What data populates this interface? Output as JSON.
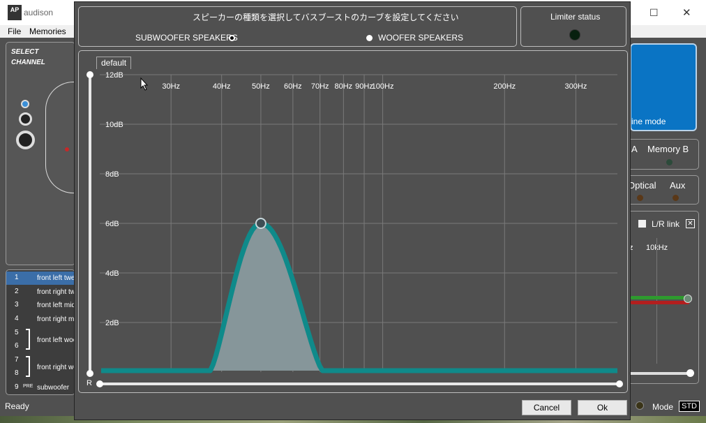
{
  "app": {
    "title": "audison",
    "logo_text": "AP",
    "menu": [
      "File",
      "Memories"
    ],
    "window_controls": {
      "maximize": "☐",
      "close": "✕"
    }
  },
  "left_panel": {
    "select_channel": "SELECT CHANNEL",
    "channels": [
      {
        "num": "1",
        "label": "front left twe"
      },
      {
        "num": "2",
        "label": "front right tw"
      },
      {
        "num": "3",
        "label": "front left mid"
      },
      {
        "num": "4",
        "label": "front right mi"
      },
      {
        "num": "5",
        "label": ""
      },
      {
        "num": "6",
        "label": "front left woo"
      },
      {
        "num": "7",
        "label": ""
      },
      {
        "num": "8",
        "label": "front right wo"
      },
      {
        "num": "9",
        "pre": "PRE",
        "label": "subwoofer"
      }
    ],
    "status": "Ready"
  },
  "right_panel": {
    "mode_label": "ine mode",
    "memory_a": "A",
    "memory_b": "Memory B",
    "optical": "Optical",
    "aux": "Aux",
    "lr_link": "L/R link",
    "freq_z": "z",
    "freq_10k": "10kHz",
    "mode": "Mode",
    "mode_value": "STD"
  },
  "dialog": {
    "instruction": "スピーカーの種類を選択してバスブーストのカーブを設定してください",
    "speaker_options": [
      {
        "label": "SUBWOOFER SPEAKERS",
        "selected": true
      },
      {
        "label": "WOOFER SPEAKERS",
        "selected": false
      }
    ],
    "limiter_status": "Limiter status",
    "default_label": "default",
    "r_label": "R",
    "cancel": "Cancel",
    "ok": "Ok"
  },
  "chart_data": {
    "type": "area",
    "x_unit": "Hz",
    "y_unit": "dB",
    "x_tick_labels": [
      "30Hz",
      "40Hz",
      "50Hz",
      "60Hz",
      "70Hz",
      "80Hz",
      "90Hz",
      "100Hz",
      "200Hz",
      "300Hz"
    ],
    "x_ticks": [
      30,
      40,
      50,
      60,
      70,
      80,
      90,
      100,
      200,
      300
    ],
    "y_tick_labels": [
      "12dB",
      "10dB",
      "8dB",
      "6dB",
      "4dB",
      "2dB"
    ],
    "y_ticks": [
      12,
      10,
      8,
      6,
      4,
      2
    ],
    "ylim": [
      0,
      12
    ],
    "xlim": [
      20,
      380
    ],
    "curve": {
      "center_hz": 50,
      "peak_db": 6,
      "start_hz": 37.5,
      "end_hz": 71
    },
    "colors": {
      "curve": "#0f8a8a",
      "fill": "#86969a",
      "grid": "#7a7a7a",
      "background": "#505050"
    }
  }
}
